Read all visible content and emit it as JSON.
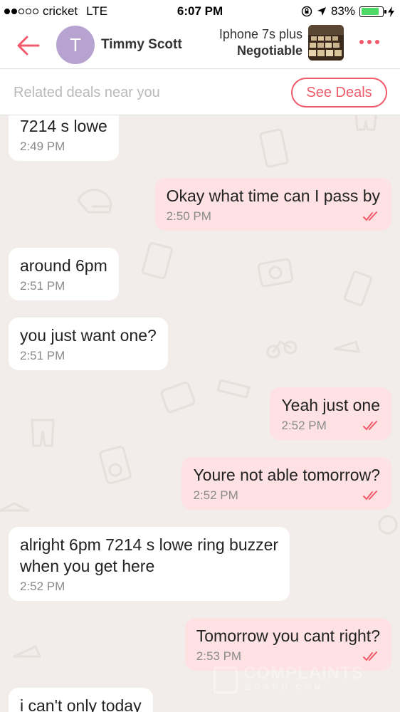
{
  "status_bar": {
    "carrier": "cricket",
    "network": "LTE",
    "time": "6:07 PM",
    "battery": "83%",
    "battery_level": 0.83
  },
  "header": {
    "avatar_letter": "T",
    "contact_name": "Timmy Scott",
    "item_title": "Iphone 7s plus",
    "item_price": "Negotiable"
  },
  "deals": {
    "prompt": "Related deals near you",
    "button_label": "See Deals"
  },
  "messages": [
    {
      "dir": "in",
      "text": "7214 s lowe",
      "time": "2:49 PM"
    },
    {
      "dir": "out",
      "text": "Okay what time can I pass by",
      "time": "2:50 PM"
    },
    {
      "dir": "in",
      "text": "around 6pm",
      "time": "2:51 PM"
    },
    {
      "dir": "in",
      "text": "you just want one?",
      "time": "2:51 PM"
    },
    {
      "dir": "out",
      "text": "Yeah just one",
      "time": "2:52 PM"
    },
    {
      "dir": "out",
      "text": "Youre not able tomorrow?",
      "time": "2:52 PM"
    },
    {
      "dir": "in",
      "text": "alright 6pm 7214 s lowe ring buzzer",
      "text2": "when you get here",
      "time": "2:52 PM"
    },
    {
      "dir": "out",
      "text": "Tomorrow you cant right?",
      "time": "2:53 PM"
    },
    {
      "dir": "in",
      "text": "i can't only today",
      "time": ""
    }
  ],
  "watermark": {
    "line1": "COMPLAINTS",
    "line2": "BOARD.COM"
  },
  "colors": {
    "accent": "#f05a6a",
    "outgoing_bubble": "#fde1e3",
    "incoming_bubble": "#ffffff",
    "background": "#f2edea",
    "avatar": "#b7a3cf"
  }
}
